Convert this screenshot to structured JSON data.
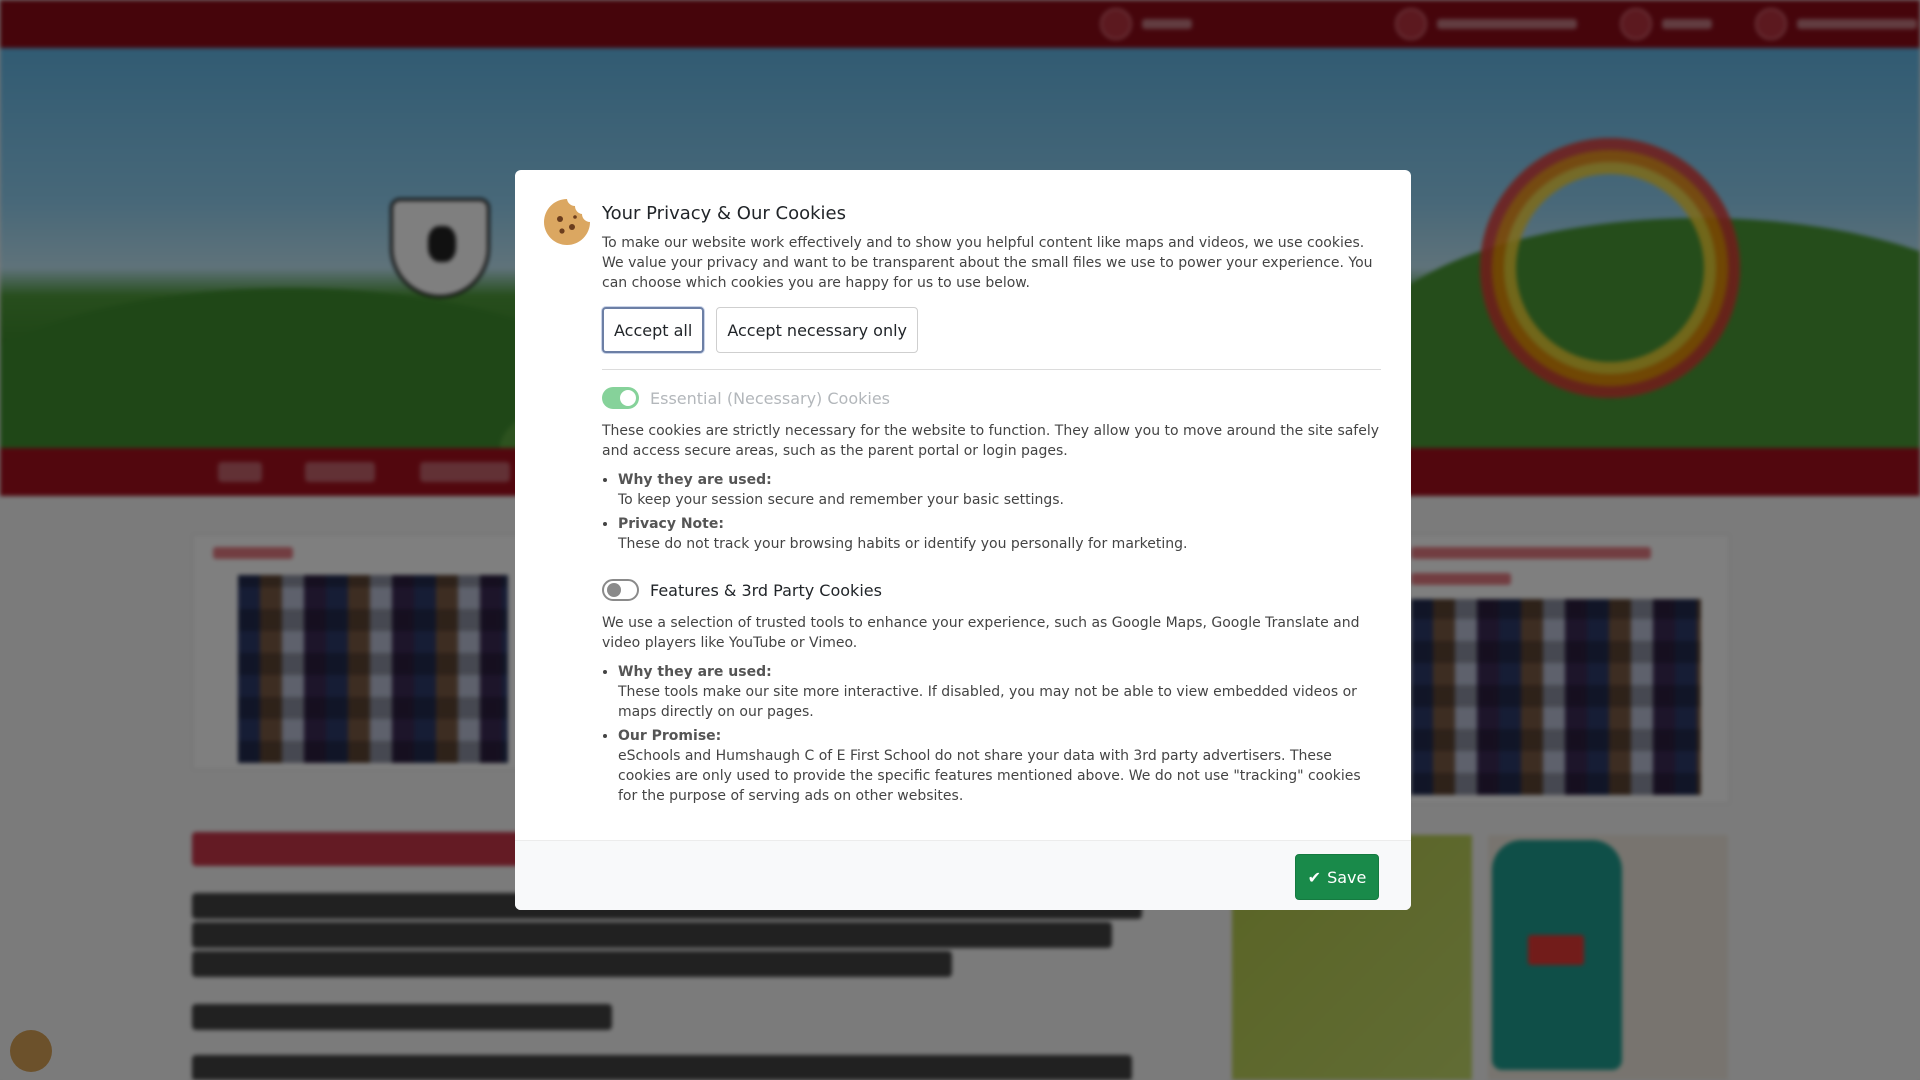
{
  "cookie_modal": {
    "title": "Your Privacy & Our Cookies",
    "intro": "To make our website work effectively and to show you helpful content like maps and videos, we use cookies. We value your privacy and want to be transparent about the small files we use to power your experience. You can choose which cookies you are happy for us to use below.",
    "accept_all_label": "Accept all",
    "accept_necessary_label": "Accept necessary only",
    "essential": {
      "title": "Essential (Necessary) Cookies",
      "enabled": true,
      "locked": true,
      "description": "These cookies are strictly necessary for the website to function. They allow you to move around the site safely and access secure areas, such as the parent portal or login pages.",
      "points": [
        {
          "heading": "Why they are used:",
          "text": "To keep your session secure and remember your basic settings."
        },
        {
          "heading": "Privacy Note:",
          "text": "These do not track your browsing habits or identify you personally for marketing."
        }
      ]
    },
    "features": {
      "title": "Features & 3rd Party Cookies",
      "enabled": false,
      "description": "We use a selection of trusted tools to enhance your experience, such as Google Maps, Google Translate and video players like YouTube or Vimeo.",
      "points": [
        {
          "heading": "Why they are used:",
          "text": "These tools make our site more interactive. If disabled, you may not be able to view embedded videos or maps directly on our pages."
        },
        {
          "heading": "Our Promise:",
          "text": "eSchools and Humshaugh C of E First School do not share your data with 3rd party advertisers. These cookies are only used to provide the specific features mentioned above. We do not use \"tracking\" cookies for the purpose of serving ads on other websites."
        }
      ]
    },
    "save_label": "Save"
  },
  "icons": {
    "cookie": "cookie-icon",
    "check": "check-icon",
    "floating_cookie": "cookie-settings-icon"
  },
  "colors": {
    "topbar": "#8c0a17",
    "navbar": "#a50f1d",
    "save_button": "#198a4a",
    "toggle_on": "#86d29a"
  }
}
